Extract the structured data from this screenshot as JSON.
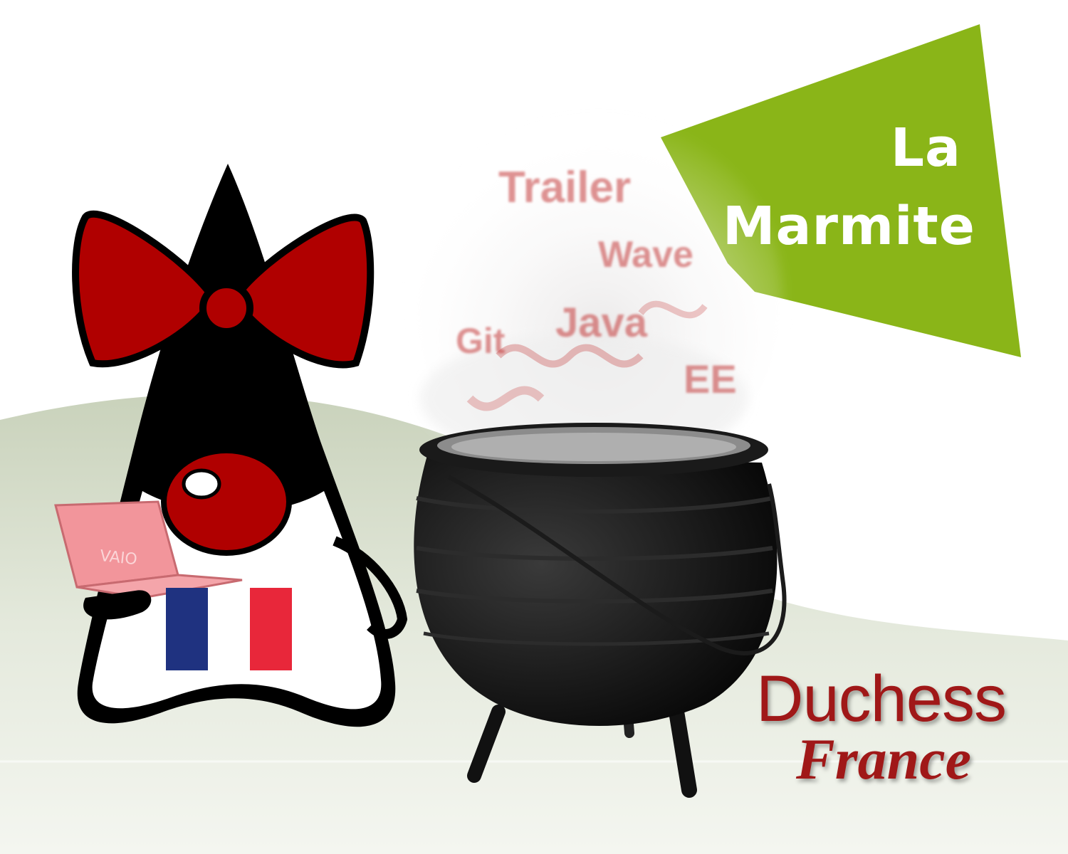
{
  "banner": {
    "line1": "La",
    "line2": "Marmite",
    "color": "#8ab518"
  },
  "brand": {
    "line1": "Duchess",
    "line2": "France",
    "color": "#a01818"
  },
  "steam": {
    "words": [
      "Trailer",
      "Wave",
      "Java",
      "Git",
      "EE"
    ]
  },
  "mascot": {
    "laptop_label": "VAIO"
  },
  "colors": {
    "bow_red": "#b00000",
    "flag_blue": "#1f3280",
    "flag_red": "#e8273a",
    "ground": "#dfe5d6"
  },
  "icons": [
    "duke-mascot-icon",
    "laptop-icon",
    "france-flag-icon",
    "cauldron-icon"
  ]
}
